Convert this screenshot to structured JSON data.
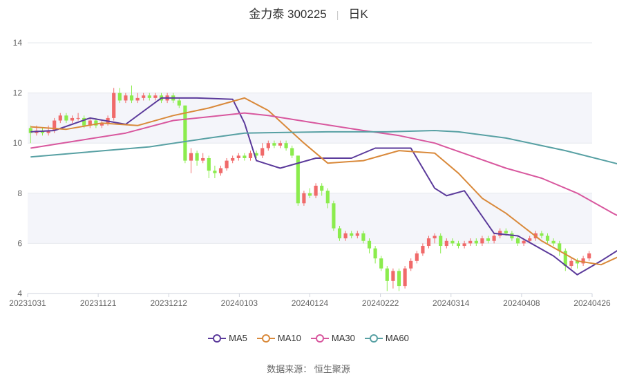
{
  "title": {
    "name": "金力泰 300225",
    "period": "日K"
  },
  "source": "数据来源： 恒生聚源",
  "chart_data": {
    "type": "candlestick",
    "title": "金力泰 300225",
    "ylim": [
      4,
      14
    ],
    "yticks": [
      4,
      6,
      8,
      10,
      12,
      14
    ],
    "xticks": [
      "20231031",
      "20231121",
      "20231212",
      "20240103",
      "20240124",
      "20240222",
      "20240314",
      "20240408",
      "20240426"
    ],
    "grid": true,
    "up_color": "#f06a6a",
    "down_color": "#8bec4d",
    "candles": [
      [
        10.6,
        10.4,
        10.7,
        10.0
      ],
      [
        10.4,
        10.5,
        10.7,
        10.3
      ],
      [
        10.5,
        10.4,
        10.6,
        10.3
      ],
      [
        10.4,
        10.5,
        10.7,
        10.3
      ],
      [
        10.5,
        10.9,
        11.0,
        10.4
      ],
      [
        10.9,
        11.1,
        11.2,
        10.8
      ],
      [
        11.1,
        10.9,
        11.2,
        10.8
      ],
      [
        10.9,
        11.0,
        11.1,
        10.8
      ],
      [
        11.0,
        11.0,
        11.2,
        10.9
      ],
      [
        11.0,
        10.7,
        11.1,
        10.6
      ],
      [
        10.7,
        10.9,
        11.0,
        10.6
      ],
      [
        10.9,
        10.7,
        11.0,
        10.6
      ],
      [
        10.7,
        10.8,
        10.9,
        10.6
      ],
      [
        10.8,
        11.0,
        11.1,
        10.7
      ],
      [
        11.0,
        12.0,
        12.2,
        10.9
      ],
      [
        12.0,
        11.7,
        12.2,
        11.6
      ],
      [
        11.7,
        11.9,
        12.0,
        11.6
      ],
      [
        11.9,
        11.7,
        12.3,
        11.6
      ],
      [
        11.7,
        11.8,
        12.0,
        11.6
      ],
      [
        11.8,
        11.9,
        12.0,
        11.7
      ],
      [
        11.9,
        11.8,
        12.0,
        11.7
      ],
      [
        11.8,
        11.9,
        12.0,
        11.7
      ],
      [
        11.9,
        11.7,
        12.0,
        11.6
      ],
      [
        11.7,
        11.9,
        12.0,
        11.6
      ],
      [
        11.9,
        11.7,
        12.0,
        11.6
      ],
      [
        11.7,
        11.5,
        11.8,
        11.4
      ],
      [
        11.5,
        9.3,
        11.5,
        9.2
      ],
      [
        9.3,
        9.6,
        9.8,
        8.8
      ],
      [
        9.6,
        9.3,
        9.7,
        9.1
      ],
      [
        9.3,
        9.4,
        9.6,
        9.2
      ],
      [
        9.4,
        8.9,
        9.5,
        8.6
      ],
      [
        8.9,
        8.8,
        9.1,
        8.6
      ],
      [
        8.8,
        9.0,
        9.1,
        8.7
      ],
      [
        9.0,
        9.3,
        9.4,
        8.9
      ],
      [
        9.3,
        9.4,
        9.5,
        9.2
      ],
      [
        9.4,
        9.5,
        9.6,
        9.3
      ],
      [
        9.5,
        9.4,
        9.6,
        9.3
      ],
      [
        9.4,
        9.6,
        9.7,
        9.3
      ],
      [
        9.6,
        9.5,
        9.7,
        9.4
      ],
      [
        9.5,
        9.8,
        10.0,
        9.4
      ],
      [
        9.8,
        10.0,
        10.1,
        9.7
      ],
      [
        10.0,
        9.9,
        10.1,
        9.8
      ],
      [
        9.9,
        10.0,
        10.1,
        9.8
      ],
      [
        10.0,
        9.8,
        10.1,
        9.7
      ],
      [
        9.8,
        9.5,
        9.9,
        9.4
      ],
      [
        9.5,
        7.6,
        9.5,
        7.5
      ],
      [
        7.6,
        8.0,
        8.1,
        7.5
      ],
      [
        8.0,
        7.9,
        8.2,
        7.8
      ],
      [
        7.9,
        8.3,
        8.4,
        7.8
      ],
      [
        8.3,
        8.1,
        8.4,
        7.9
      ],
      [
        8.1,
        7.6,
        8.2,
        7.4
      ],
      [
        7.6,
        6.6,
        7.7,
        6.5
      ],
      [
        6.6,
        6.2,
        6.7,
        6.1
      ],
      [
        6.2,
        6.4,
        6.5,
        6.1
      ],
      [
        6.4,
        6.3,
        6.5,
        6.2
      ],
      [
        6.3,
        6.4,
        6.5,
        6.2
      ],
      [
        6.4,
        6.1,
        6.5,
        6.0
      ],
      [
        6.1,
        5.8,
        6.2,
        5.6
      ],
      [
        5.8,
        5.4,
        5.9,
        5.2
      ],
      [
        5.4,
        5.0,
        5.5,
        4.9
      ],
      [
        5.0,
        4.5,
        5.1,
        4.1
      ],
      [
        4.5,
        4.9,
        5.0,
        4.2
      ],
      [
        4.9,
        4.3,
        5.0,
        4.1
      ],
      [
        4.3,
        5.0,
        5.1,
        4.2
      ],
      [
        5.0,
        5.3,
        5.4,
        4.9
      ],
      [
        5.3,
        5.6,
        5.7,
        5.2
      ],
      [
        5.6,
        5.9,
        6.0,
        5.5
      ],
      [
        5.9,
        6.2,
        6.3,
        5.8
      ],
      [
        6.2,
        6.3,
        6.4,
        6.0
      ],
      [
        6.3,
        5.9,
        6.4,
        5.6
      ],
      [
        5.9,
        6.1,
        6.2,
        5.8
      ],
      [
        6.1,
        6.0,
        6.2,
        5.9
      ],
      [
        6.0,
        5.9,
        6.1,
        5.8
      ],
      [
        5.9,
        6.0,
        6.1,
        5.8
      ],
      [
        6.0,
        6.1,
        6.2,
        5.9
      ],
      [
        6.1,
        6.0,
        6.2,
        5.9
      ],
      [
        6.0,
        6.2,
        6.3,
        5.9
      ],
      [
        6.2,
        6.1,
        6.3,
        6.0
      ],
      [
        6.1,
        6.3,
        6.4,
        6.0
      ],
      [
        6.3,
        6.5,
        6.6,
        6.2
      ],
      [
        6.5,
        6.4,
        6.6,
        6.3
      ],
      [
        6.4,
        6.2,
        6.5,
        6.1
      ],
      [
        6.2,
        6.0,
        6.3,
        5.9
      ],
      [
        6.0,
        6.1,
        6.2,
        5.9
      ],
      [
        6.1,
        6.2,
        6.3,
        6.0
      ],
      [
        6.2,
        6.4,
        6.5,
        6.1
      ],
      [
        6.4,
        6.3,
        6.5,
        6.2
      ],
      [
        6.3,
        6.1,
        6.4,
        6.0
      ],
      [
        6.1,
        6.0,
        6.2,
        5.9
      ],
      [
        6.0,
        5.7,
        6.1,
        5.5
      ],
      [
        5.7,
        5.1,
        5.8,
        4.9
      ],
      [
        5.1,
        5.3,
        5.4,
        5.0
      ],
      [
        5.3,
        5.2,
        5.4,
        5.0
      ],
      [
        5.2,
        5.4,
        5.5,
        5.1
      ],
      [
        5.4,
        5.6,
        5.7,
        5.3
      ]
    ],
    "series": [
      {
        "name": "MA5",
        "color": "#5b3a9b",
        "values": [
          [
            0,
            10.45
          ],
          [
            4,
            10.5
          ],
          [
            10,
            11.0
          ],
          [
            16,
            10.75
          ],
          [
            22,
            11.8
          ],
          [
            28,
            11.8
          ],
          [
            34,
            11.75
          ],
          [
            36,
            10.8
          ],
          [
            38,
            9.3
          ],
          [
            42,
            9.0
          ],
          [
            48,
            9.4
          ],
          [
            54,
            9.4
          ],
          [
            58,
            9.8
          ],
          [
            64,
            9.8
          ],
          [
            68,
            8.2
          ],
          [
            70,
            7.9
          ],
          [
            73,
            8.1
          ],
          [
            78,
            6.4
          ],
          [
            82,
            6.3
          ],
          [
            88,
            5.5
          ],
          [
            92,
            4.75
          ],
          [
            96,
            5.3
          ],
          [
            100,
            5.9
          ],
          [
            104,
            6.2
          ],
          [
            110,
            6.0
          ],
          [
            118,
            5.95
          ],
          [
            124,
            6.2
          ],
          [
            130,
            6.4
          ],
          [
            136,
            6.3
          ],
          [
            140,
            6.1
          ],
          [
            144,
            6.2
          ],
          [
            150,
            6.2
          ],
          [
            154,
            5.6
          ],
          [
            158,
            5.3
          ],
          [
            160,
            5.2
          ],
          [
            164,
            5.35
          ],
          [
            166,
            5.5
          ]
        ]
      },
      {
        "name": "MA10",
        "color": "#d9893a",
        "values": [
          [
            0,
            10.65
          ],
          [
            6,
            10.55
          ],
          [
            12,
            10.8
          ],
          [
            18,
            10.7
          ],
          [
            24,
            11.1
          ],
          [
            30,
            11.4
          ],
          [
            36,
            11.8
          ],
          [
            40,
            11.3
          ],
          [
            46,
            10.0
          ],
          [
            50,
            9.2
          ],
          [
            56,
            9.3
          ],
          [
            62,
            9.7
          ],
          [
            68,
            9.6
          ],
          [
            72,
            8.8
          ],
          [
            76,
            7.8
          ],
          [
            80,
            7.2
          ],
          [
            86,
            6.1
          ],
          [
            92,
            5.3
          ],
          [
            96,
            5.15
          ],
          [
            102,
            5.8
          ],
          [
            108,
            6.1
          ],
          [
            114,
            6.0
          ],
          [
            120,
            6.0
          ],
          [
            126,
            6.1
          ],
          [
            132,
            6.2
          ],
          [
            140,
            6.2
          ],
          [
            146,
            6.1
          ],
          [
            152,
            5.9
          ],
          [
            158,
            5.5
          ],
          [
            164,
            5.3
          ],
          [
            166,
            5.35
          ]
        ]
      },
      {
        "name": "MA30",
        "color": "#d8579e",
        "values": [
          [
            0,
            9.8
          ],
          [
            8,
            10.1
          ],
          [
            16,
            10.4
          ],
          [
            24,
            10.9
          ],
          [
            30,
            11.05
          ],
          [
            36,
            11.2
          ],
          [
            40,
            11.1
          ],
          [
            48,
            10.8
          ],
          [
            56,
            10.5
          ],
          [
            62,
            10.3
          ],
          [
            68,
            10.0
          ],
          [
            74,
            9.5
          ],
          [
            80,
            9.0
          ],
          [
            86,
            8.6
          ],
          [
            92,
            8.0
          ],
          [
            98,
            7.2
          ],
          [
            104,
            6.5
          ],
          [
            110,
            6.1
          ],
          [
            118,
            5.85
          ],
          [
            126,
            5.8
          ],
          [
            134,
            5.85
          ],
          [
            142,
            6.05
          ],
          [
            150,
            6.1
          ],
          [
            156,
            6.05
          ],
          [
            162,
            5.95
          ],
          [
            166,
            5.9
          ]
        ]
      },
      {
        "name": "MA60",
        "color": "#57a0a3",
        "values": [
          [
            0,
            9.45
          ],
          [
            10,
            9.65
          ],
          [
            20,
            9.85
          ],
          [
            30,
            10.2
          ],
          [
            36,
            10.4
          ],
          [
            50,
            10.45
          ],
          [
            60,
            10.45
          ],
          [
            68,
            10.5
          ],
          [
            72,
            10.45
          ],
          [
            80,
            10.2
          ],
          [
            90,
            9.7
          ],
          [
            100,
            9.1
          ],
          [
            110,
            8.4
          ],
          [
            120,
            7.6
          ],
          [
            128,
            7.1
          ],
          [
            136,
            6.9
          ],
          [
            144,
            6.6
          ],
          [
            152,
            6.35
          ],
          [
            158,
            6.1
          ],
          [
            162,
            6.0
          ],
          [
            166,
            5.88
          ]
        ]
      }
    ]
  }
}
